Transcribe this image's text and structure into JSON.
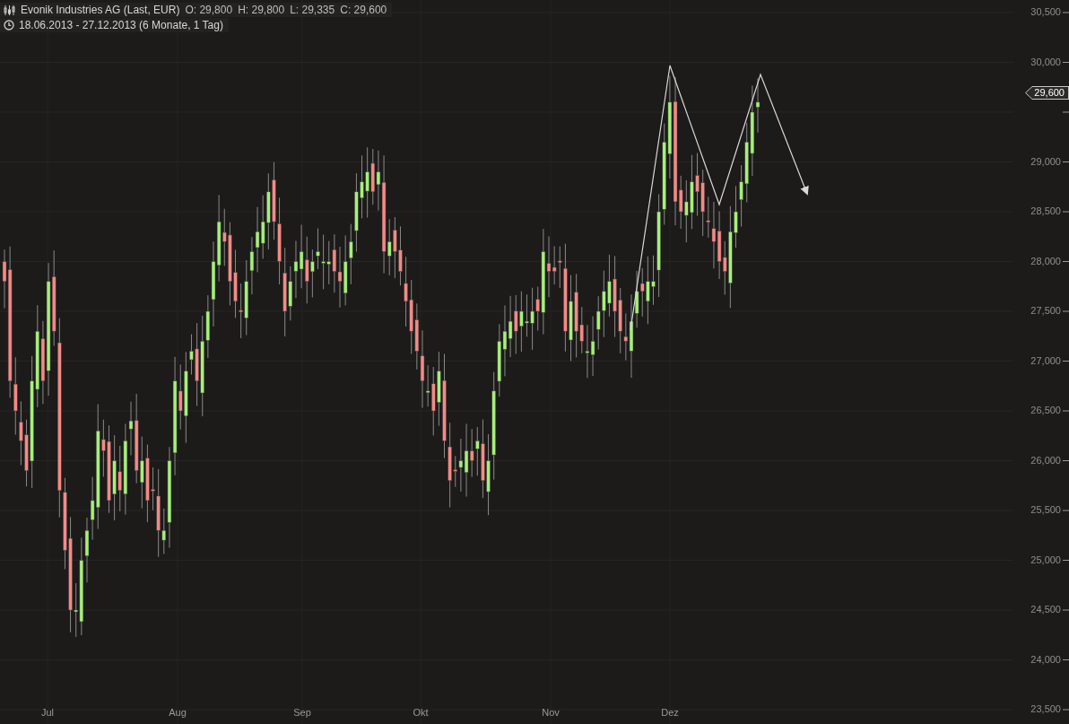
{
  "header": {
    "title": "Evonik Industries AG (Last, EUR)",
    "quotes": [
      "O: 29,800",
      "H: 29,800",
      "L: 29,335",
      "C: 29,600"
    ],
    "range": "18.06.2013 - 27.12.2013 (6 Monate, 1 Tag)"
  },
  "y_axis": [
    "30,500",
    "30,000",
    "29,000",
    "28,500",
    "28,000",
    "27,500",
    "27,000",
    "26,500",
    "26,000",
    "25,500",
    "25,000",
    "24,500",
    "24,000",
    "23,500"
  ],
  "x_axis": [
    "Jul",
    "Aug",
    "Sep",
    "Okt",
    "Nov",
    "Dez"
  ],
  "price_marker": "29,600"
}
